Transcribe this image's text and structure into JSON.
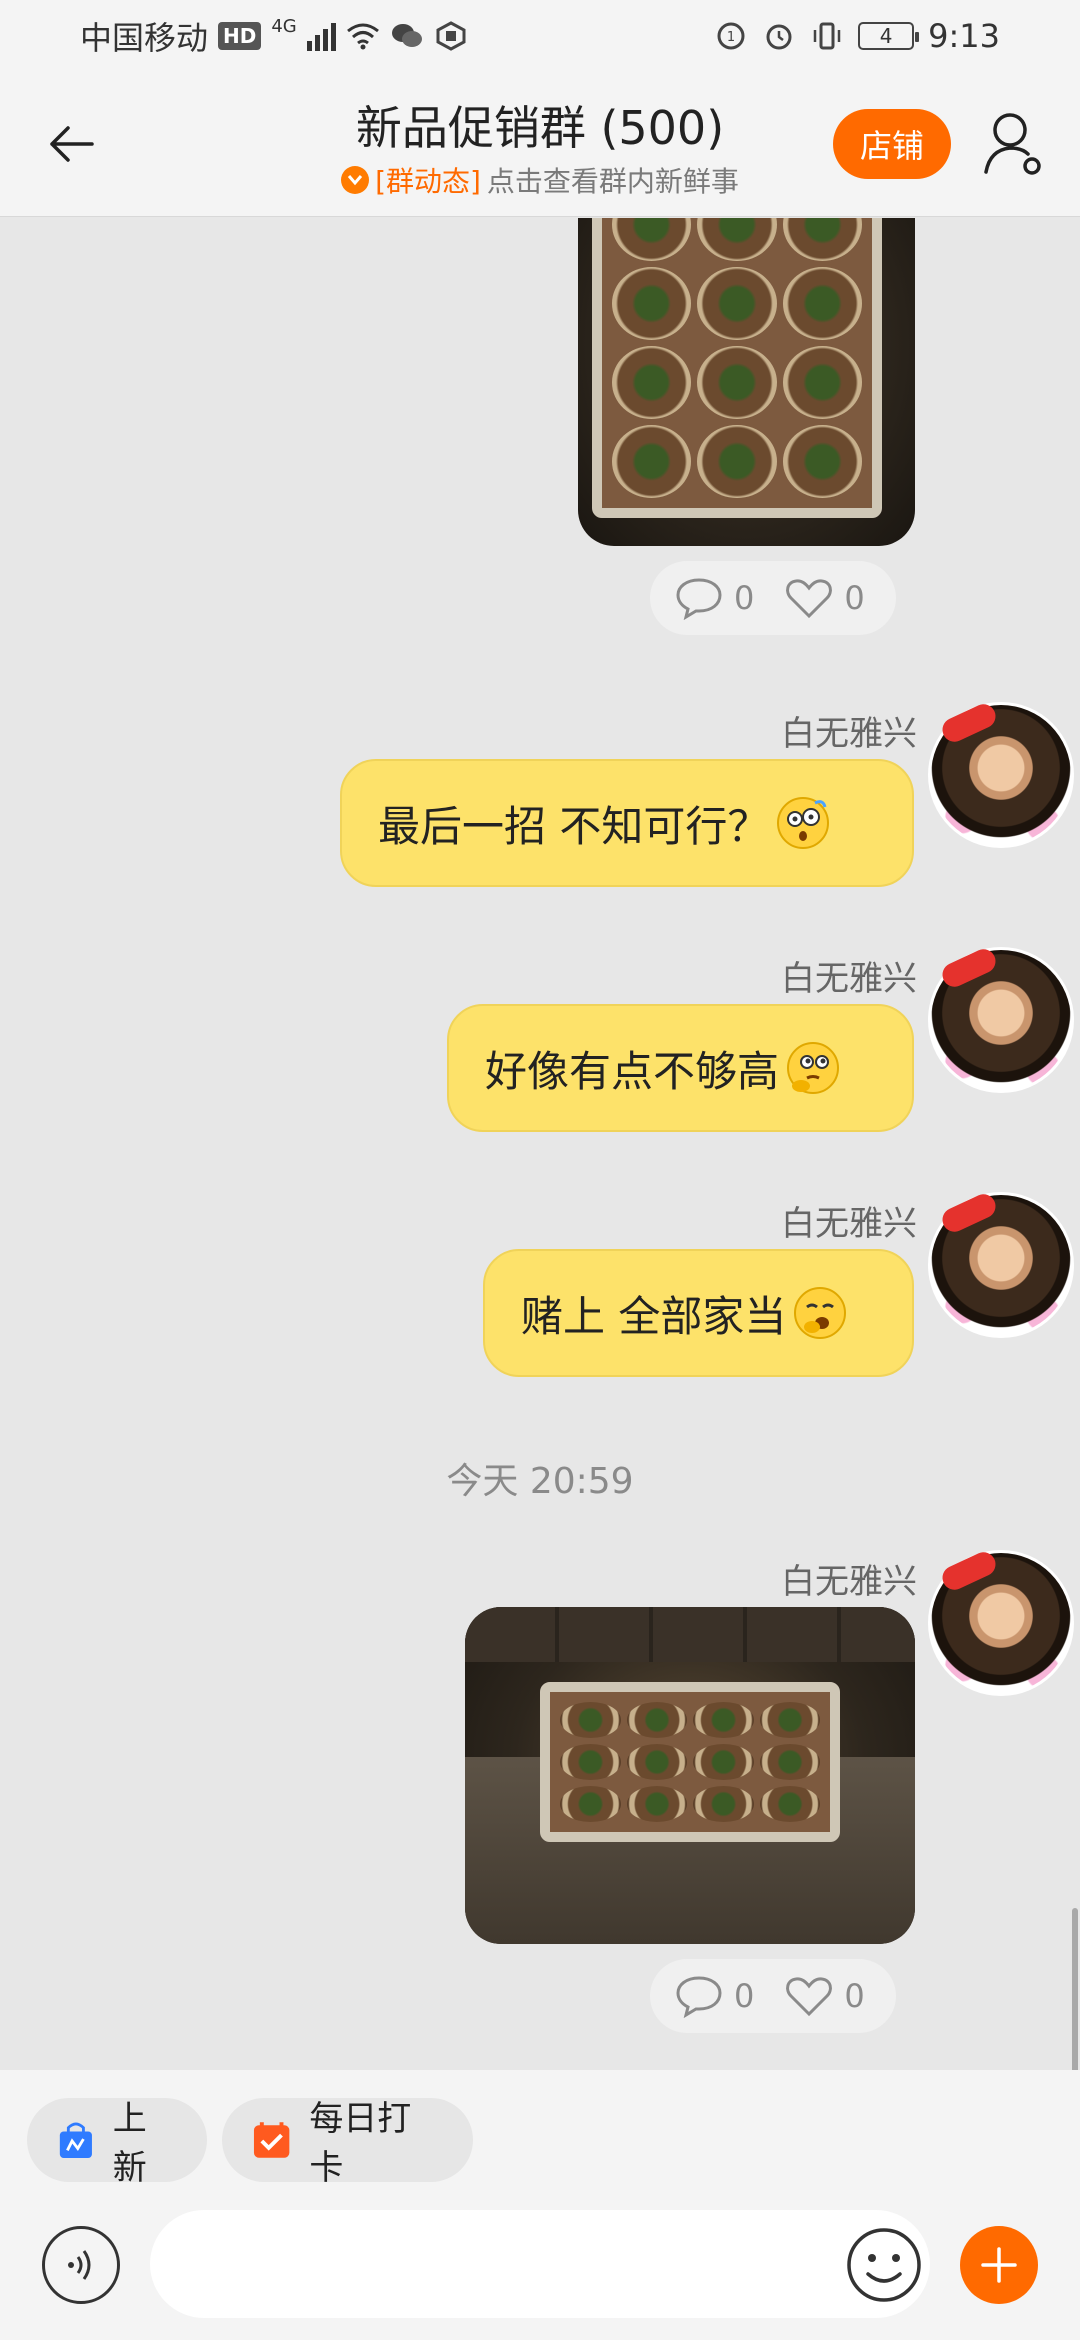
{
  "status_bar": {
    "carrier": "中国移动",
    "hd": "HD",
    "network": "4G",
    "battery": "4",
    "time": "9:13"
  },
  "header": {
    "title": "新品促销群 (500)",
    "subtitle_tag": "[群动态]",
    "subtitle_text": "点击查看群内新鲜事",
    "shop_button": "店铺"
  },
  "messages": [
    {
      "type": "image",
      "description_icon": "succulent-tray-photo",
      "comments": "0",
      "likes": "0"
    },
    {
      "type": "text",
      "sender": "白无雅兴",
      "text": "最后一招 不知可行？",
      "emoji": "dizzy-face"
    },
    {
      "type": "text",
      "sender": "白无雅兴",
      "text": "好像有点不够高",
      "emoji": "thinking-face"
    },
    {
      "type": "text",
      "sender": "白无雅兴",
      "text": "赌上 全部家当",
      "emoji": "yawning-face"
    },
    {
      "type": "timestamp",
      "text": "今天  20:59"
    },
    {
      "type": "image",
      "sender": "白无雅兴",
      "description_icon": "succulent-tray-photo",
      "comments": "0",
      "likes": "0"
    }
  ],
  "quick_actions": [
    {
      "label": "上新",
      "icon": "new-arrival-bag-icon",
      "color": "#2f7bff"
    },
    {
      "label": "每日打卡",
      "icon": "calendar-check-icon",
      "color": "#ff5a1f"
    }
  ],
  "input": {
    "placeholder": ""
  },
  "colors": {
    "accent": "#ff6a00",
    "bubble": "#fde26a",
    "background": "#e7e7e7"
  }
}
